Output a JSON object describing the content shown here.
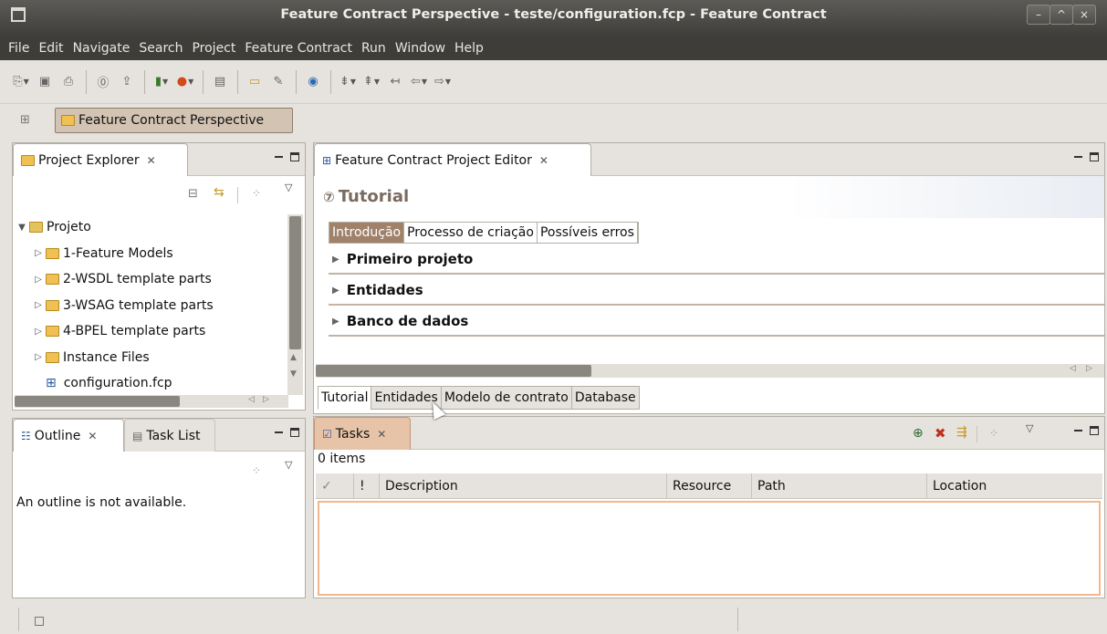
{
  "window": {
    "title": "Feature Contract Perspective - teste/configuration.fcp - Feature Contract",
    "controls": [
      "–",
      "^",
      "×"
    ]
  },
  "menu": [
    "File",
    "Edit",
    "Navigate",
    "Search",
    "Project",
    "Feature Contract",
    "Run",
    "Window",
    "Help"
  ],
  "perspective": {
    "label": "Feature Contract Perspective"
  },
  "project_explorer": {
    "tab_label": "Project Explorer",
    "tree": [
      {
        "label": "Projeto",
        "expanded": true
      },
      {
        "label": "1-Feature Models"
      },
      {
        "label": "2-WSDL template parts"
      },
      {
        "label": "3-WSAG template parts"
      },
      {
        "label": "4-BPEL template parts"
      },
      {
        "label": "Instance Files"
      },
      {
        "label": "configuration.fcp"
      }
    ]
  },
  "outline": {
    "tab_label": "Outline",
    "tab2_label": "Task List",
    "message": "An outline is not available."
  },
  "editor": {
    "tab_label": "Feature Contract Project Editor",
    "section_title": "Tutorial",
    "subtabs": [
      "Introdução",
      "Processo de criação",
      "Possíveis erros"
    ],
    "sections": [
      "Primeiro projeto",
      "Entidades",
      "Banco de dados"
    ],
    "bottom_tabs": [
      "Tutorial",
      "Entidades",
      "Modelo de contrato",
      "Database"
    ]
  },
  "tasks": {
    "tab_label": "Tasks",
    "count": "0 items",
    "columns": [
      "✓",
      "!",
      "Description",
      "Resource",
      "Path",
      "Location"
    ]
  },
  "colors": {
    "accent": "#a0826b",
    "title_bar": "#3f3e3a",
    "highlight_border": "#f1b78c"
  }
}
